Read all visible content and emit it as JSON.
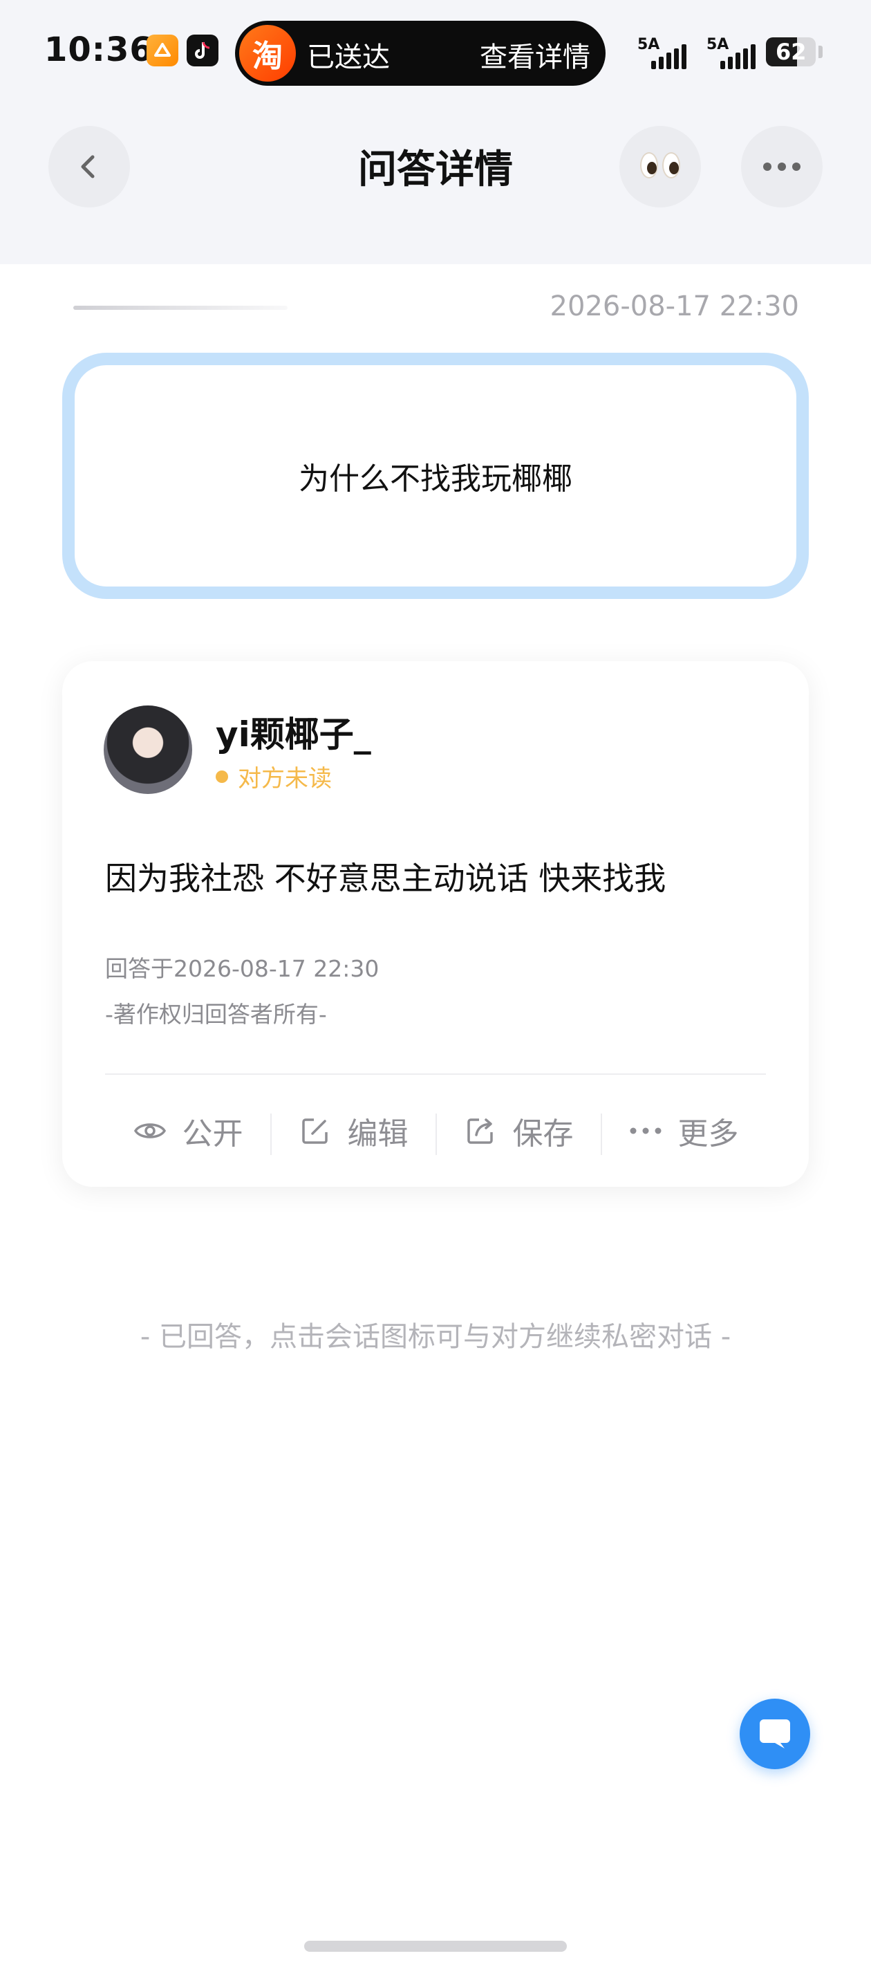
{
  "status_bar": {
    "time": "10:36",
    "notification": {
      "app_icon_text": "淘",
      "status": "已送达",
      "action": "查看详情"
    },
    "signal1_label": "5A",
    "signal2_label": "5A",
    "battery": "62",
    "battery_level": 0.62
  },
  "nav": {
    "title": "问答详情",
    "back_icon": "chevron-left-icon",
    "eyes_icon": "eyes-emoji-icon",
    "more_icon": "ellipsis-icon"
  },
  "question": {
    "date": "2026-08-17 22:30",
    "text": "为什么不找我玩椰椰"
  },
  "answer_card": {
    "username": "yi颗椰子_",
    "read_status": "对方未读",
    "answer_text": "因为我社恐 不好意思主动说话 快来找我",
    "answered_at": "回答于2026-08-17 22:30",
    "copyright": "-著作权归回答者所有-",
    "actions": [
      {
        "label": "公开",
        "icon": "eye-icon"
      },
      {
        "label": "编辑",
        "icon": "edit-icon"
      },
      {
        "label": "保存",
        "icon": "share-icon"
      },
      {
        "label": "更多",
        "icon": "more-icon"
      }
    ]
  },
  "hint": "- 已回答，点击会话图标可与对方继续私密对话 -",
  "colors": {
    "accent": "#2f8ff5",
    "question_border": "#c4e1fb",
    "unread": "#f5b94a",
    "muted": "#8b8b90"
  }
}
